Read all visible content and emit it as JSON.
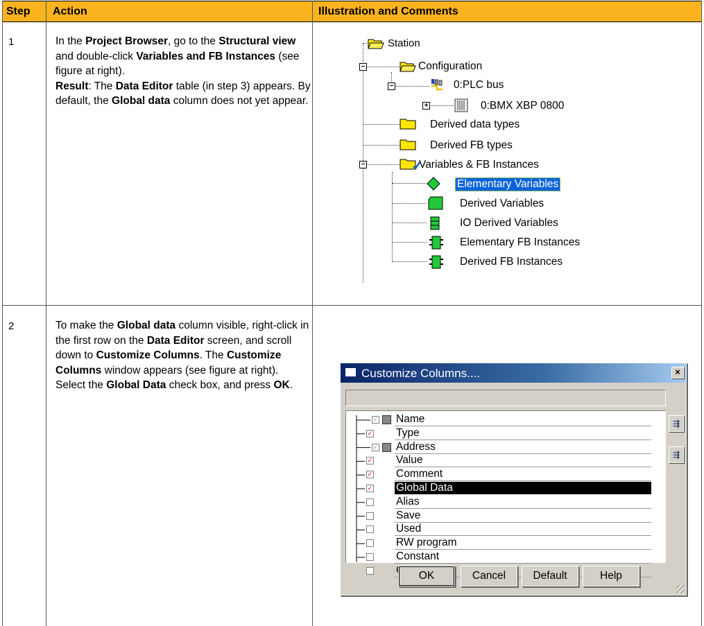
{
  "header": {
    "col_step": "Step",
    "col_action": "Action",
    "col_illustration": "Illustration and Comments"
  },
  "rows": [
    {
      "step": "1",
      "text": [
        {
          "t": "In the ",
          "b": false
        },
        {
          "t": "Project Browser",
          "b": true
        },
        {
          "t": ", go to the ",
          "b": false
        },
        {
          "t": "Structural view",
          "b": true
        },
        {
          "t": " and double-click ",
          "b": false
        },
        {
          "t": "Variables and FB Instances",
          "b": true
        },
        {
          "t": " (see figure at right).",
          "b": false
        },
        {
          "t": "\n",
          "b": false
        },
        {
          "t": "Result",
          "b": true
        },
        {
          "t": ": The ",
          "b": false
        },
        {
          "t": "Data Editor",
          "b": true
        },
        {
          "t": " table (in step 3) appears. By default, the ",
          "b": false
        },
        {
          "t": "Global data",
          "b": true
        },
        {
          "t": " column does not yet appear.",
          "b": false
        }
      ]
    },
    {
      "step": "2",
      "text": [
        {
          "t": "To make the ",
          "b": false
        },
        {
          "t": "Global data",
          "b": true
        },
        {
          "t": " column visible, right-click in the first row on the ",
          "b": false
        },
        {
          "t": "Data Editor",
          "b": true
        },
        {
          "t": " screen, and scroll down to ",
          "b": false
        },
        {
          "t": "Customize Columns",
          "b": true
        },
        {
          "t": ". The ",
          "b": false
        },
        {
          "t": "Customize Columns",
          "b": true
        },
        {
          "t": " window appears (see figure at right).",
          "b": false
        },
        {
          "t": "\n",
          "b": false
        },
        {
          "t": "Select the ",
          "b": false
        },
        {
          "t": "Global Data",
          "b": true
        },
        {
          "t": " check box, and press ",
          "b": false
        },
        {
          "t": "OK",
          "b": true
        },
        {
          "t": ".",
          "b": false
        }
      ]
    }
  ],
  "tree": {
    "station": "Station",
    "configuration": "Configuration",
    "plc_bus": "0:PLC bus",
    "bmx": "0:BMX XBP 0800",
    "derived_data_types": "Derived data types",
    "derived_fb_types": "Derived FB types",
    "variables": "Variables & FB Instances",
    "elementary_variables": "Elementary Variables",
    "derived_variables": "Derived Variables",
    "io_derived_variables": "IO Derived Variables",
    "elementary_fb_instances": "Elementary FB Instances",
    "derived_fb_instances": "Derived FB Instances"
  },
  "dialog": {
    "title": "Customize Columns....",
    "close": "×",
    "items": [
      {
        "label": "Name",
        "checked": true,
        "locked": true
      },
      {
        "label": "Type",
        "checked": true,
        "locked": false
      },
      {
        "label": "Address",
        "checked": true,
        "locked": true
      },
      {
        "label": "Value",
        "checked": true,
        "locked": false
      },
      {
        "label": "Comment",
        "checked": true,
        "locked": false
      },
      {
        "label": "Global Data",
        "checked": true,
        "locked": false,
        "selected": true
      },
      {
        "label": "Alias",
        "checked": false,
        "locked": false
      },
      {
        "label": "Save",
        "checked": false,
        "locked": false
      },
      {
        "label": "Used",
        "checked": false,
        "locked": false
      },
      {
        "label": "RW program",
        "checked": false,
        "locked": false
      },
      {
        "label": "Constant",
        "checked": false,
        "locked": false
      },
      {
        "label": "Custom",
        "checked": false,
        "locked": false
      }
    ],
    "buttons": {
      "ok": "OK",
      "cancel": "Cancel",
      "default": "Default",
      "help": "Help"
    }
  },
  "colors": {
    "header_bg": "#fab31f",
    "selection": "#0a64d8",
    "folder": "#ffe600",
    "node_green": "#22c93a"
  }
}
